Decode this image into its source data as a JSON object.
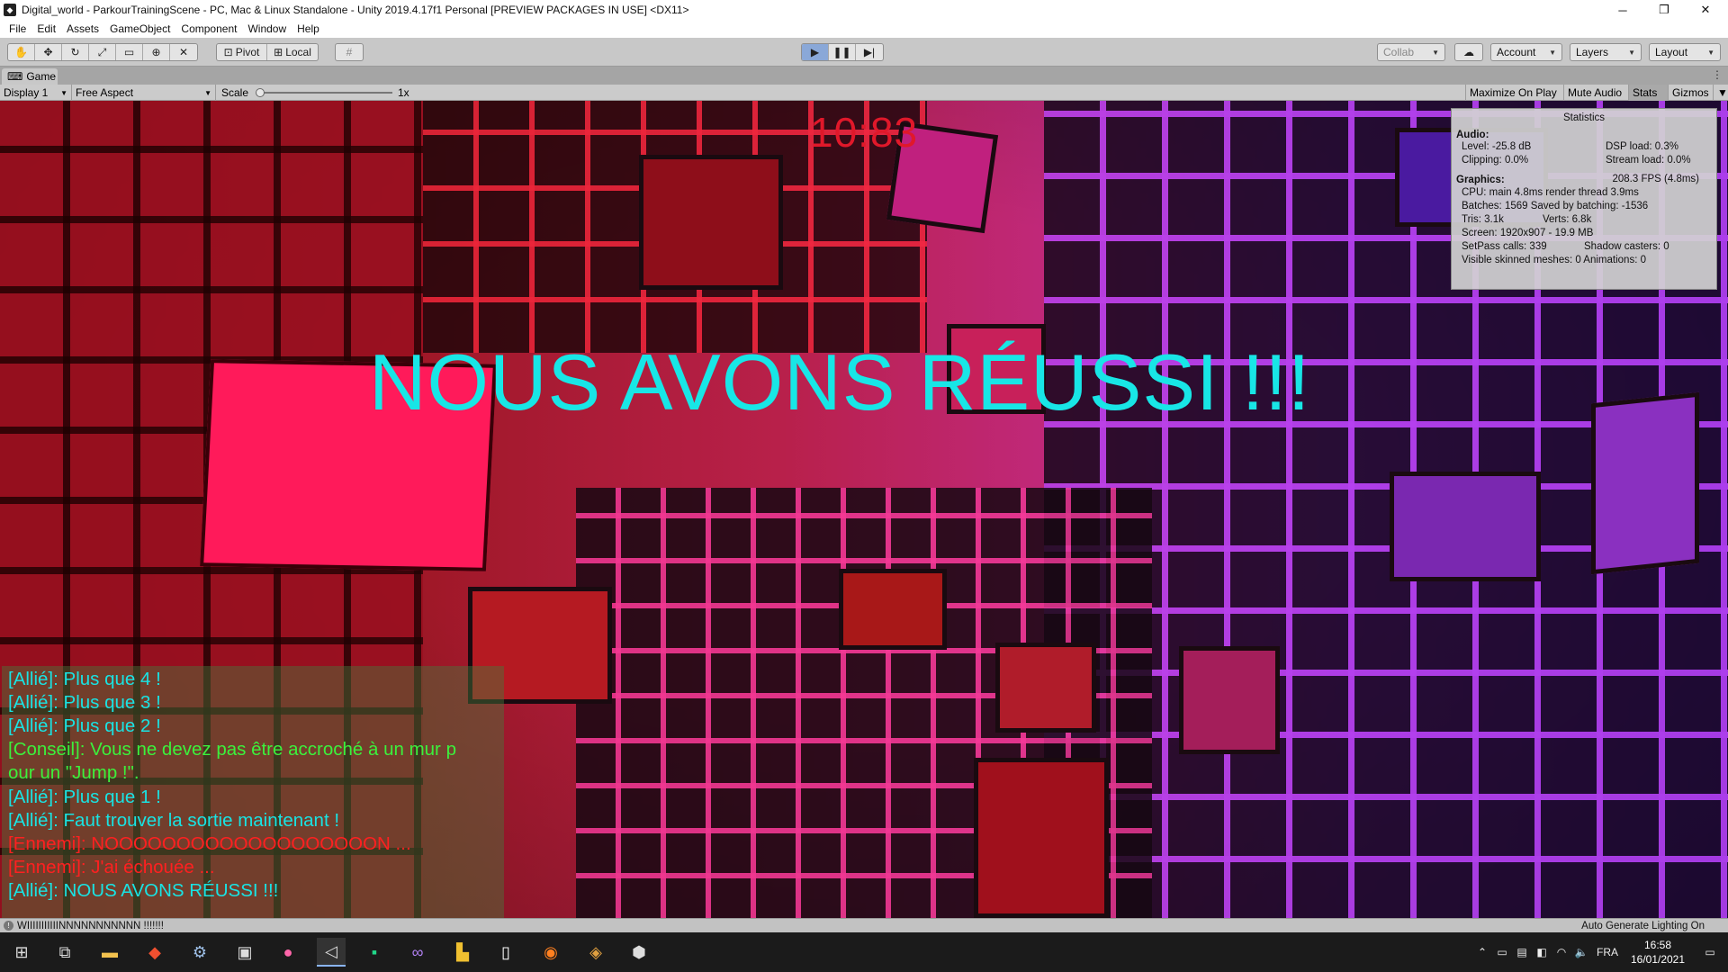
{
  "window": {
    "title": "Digital_world - ParkourTrainingScene - PC, Mac & Linux Standalone - Unity 2019.4.17f1 Personal [PREVIEW PACKAGES IN USE] <DX11>",
    "minimize": "─",
    "restore": "❐",
    "close": "✕"
  },
  "menu": [
    "File",
    "Edit",
    "Assets",
    "GameObject",
    "Component",
    "Window",
    "Help"
  ],
  "toolbar": {
    "pivot": "Pivot",
    "local": "Local",
    "collab": "Collab",
    "account": "Account",
    "layers": "Layers",
    "layout": "Layout",
    "play_active": true
  },
  "tab": {
    "label": "Game"
  },
  "viewbar": {
    "display": "Display 1",
    "aspect": "Free Aspect",
    "scale_label": "Scale",
    "scale_value": "1x",
    "maximize": "Maximize On Play",
    "mute": "Mute Audio",
    "stats": "Stats",
    "gizmos": "Gizmos"
  },
  "game": {
    "timer": "10:83",
    "headline": "NOUS AVONS RÉUSSI !!!"
  },
  "stats": {
    "title": "Statistics",
    "audio_label": "Audio:",
    "level": "Level: -25.8 dB",
    "dsp": "DSP load: 0.3%",
    "clipping": "Clipping: 0.0%",
    "stream": "Stream load: 0.0%",
    "graphics_label": "Graphics:",
    "fps": "208.3 FPS (4.8ms)",
    "cpu": "CPU: main 4.8ms  render thread 3.9ms",
    "batches": "Batches: 1569   Saved by batching: -1536",
    "tris": "Tris: 3.1k",
    "verts": "Verts: 6.8k",
    "screen": "Screen: 1920x907 - 19.9 MB",
    "setpass": "SetPass calls: 339",
    "shadow": "Shadow casters: 0",
    "skinned": "Visible skinned meshes: 0  Animations: 0"
  },
  "chat": [
    {
      "text": "[Allié]: Plus que 4 !",
      "color": "#19e3e3"
    },
    {
      "text": "[Allié]: Plus que 3 !",
      "color": "#19e3e3"
    },
    {
      "text": "[Allié]: Plus que 2 !",
      "color": "#19e3e3"
    },
    {
      "text": "[Conseil]: Vous ne devez pas être accroché à un mur p",
      "color": "#3cf03c"
    },
    {
      "text": "our un \"Jump !\".",
      "color": "#3cf03c"
    },
    {
      "text": "[Allié]: Plus que 1 !",
      "color": "#19e3e3"
    },
    {
      "text": "[Allié]: Faut trouver la sortie maintenant !",
      "color": "#19e3e3"
    },
    {
      "text": "[Ennemi]: NOOOOOOOOOOOOOOOOOOON ...",
      "color": "#ff2020"
    },
    {
      "text": "[Ennemi]: J'ai échouée ...",
      "color": "#ff2020"
    },
    {
      "text": "[Allié]: NOUS AVONS RÉUSSI !!!",
      "color": "#19e3e3"
    }
  ],
  "status": {
    "message": "WIIIIIIIIIIINNNNNNNNNNN !!!!!!!",
    "right": "Auto Generate Lighting On"
  },
  "taskbar": {
    "lang": "FRA",
    "time": "16:58",
    "date": "16/01/2021"
  }
}
